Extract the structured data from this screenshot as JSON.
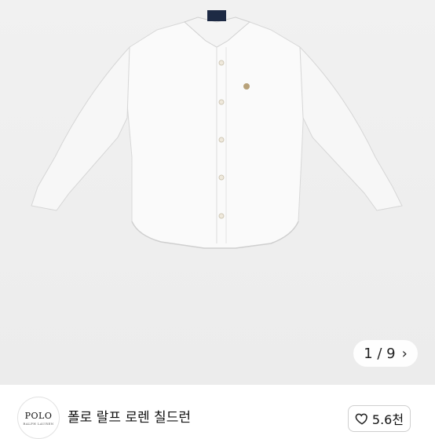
{
  "image_viewer": {
    "counter_current": "1",
    "counter_total": "9",
    "next_icon": "chevron-right-icon",
    "background": "#efefef"
  },
  "shop": {
    "logo_text": "POLO",
    "logo_subtext": "RALPH LAUREN",
    "name": "폴로 랄프 로렌 칠드런"
  },
  "like": {
    "icon": "heart-outline-icon",
    "count": "5.6천"
  }
}
